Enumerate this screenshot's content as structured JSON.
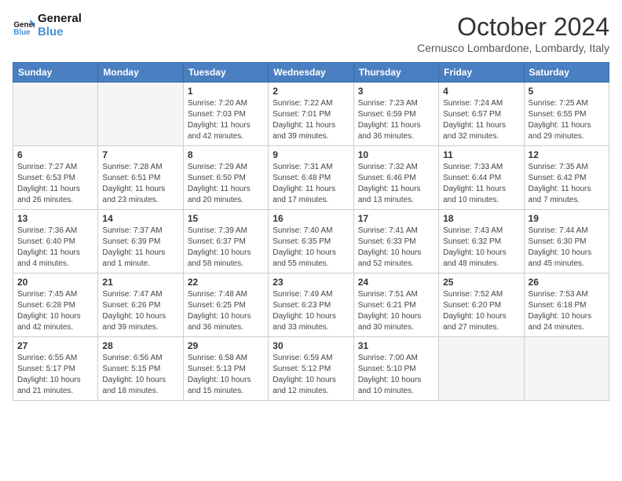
{
  "header": {
    "logo_line1": "General",
    "logo_line2": "Blue",
    "month": "October 2024",
    "location": "Cernusco Lombardone, Lombardy, Italy"
  },
  "weekdays": [
    "Sunday",
    "Monday",
    "Tuesday",
    "Wednesday",
    "Thursday",
    "Friday",
    "Saturday"
  ],
  "weeks": [
    [
      {
        "day": "",
        "info": ""
      },
      {
        "day": "",
        "info": ""
      },
      {
        "day": "1",
        "info": "Sunrise: 7:20 AM\nSunset: 7:03 PM\nDaylight: 11 hours and 42 minutes."
      },
      {
        "day": "2",
        "info": "Sunrise: 7:22 AM\nSunset: 7:01 PM\nDaylight: 11 hours and 39 minutes."
      },
      {
        "day": "3",
        "info": "Sunrise: 7:23 AM\nSunset: 6:59 PM\nDaylight: 11 hours and 36 minutes."
      },
      {
        "day": "4",
        "info": "Sunrise: 7:24 AM\nSunset: 6:57 PM\nDaylight: 11 hours and 32 minutes."
      },
      {
        "day": "5",
        "info": "Sunrise: 7:25 AM\nSunset: 6:55 PM\nDaylight: 11 hours and 29 minutes."
      }
    ],
    [
      {
        "day": "6",
        "info": "Sunrise: 7:27 AM\nSunset: 6:53 PM\nDaylight: 11 hours and 26 minutes."
      },
      {
        "day": "7",
        "info": "Sunrise: 7:28 AM\nSunset: 6:51 PM\nDaylight: 11 hours and 23 minutes."
      },
      {
        "day": "8",
        "info": "Sunrise: 7:29 AM\nSunset: 6:50 PM\nDaylight: 11 hours and 20 minutes."
      },
      {
        "day": "9",
        "info": "Sunrise: 7:31 AM\nSunset: 6:48 PM\nDaylight: 11 hours and 17 minutes."
      },
      {
        "day": "10",
        "info": "Sunrise: 7:32 AM\nSunset: 6:46 PM\nDaylight: 11 hours and 13 minutes."
      },
      {
        "day": "11",
        "info": "Sunrise: 7:33 AM\nSunset: 6:44 PM\nDaylight: 11 hours and 10 minutes."
      },
      {
        "day": "12",
        "info": "Sunrise: 7:35 AM\nSunset: 6:42 PM\nDaylight: 11 hours and 7 minutes."
      }
    ],
    [
      {
        "day": "13",
        "info": "Sunrise: 7:36 AM\nSunset: 6:40 PM\nDaylight: 11 hours and 4 minutes."
      },
      {
        "day": "14",
        "info": "Sunrise: 7:37 AM\nSunset: 6:39 PM\nDaylight: 11 hours and 1 minute."
      },
      {
        "day": "15",
        "info": "Sunrise: 7:39 AM\nSunset: 6:37 PM\nDaylight: 10 hours and 58 minutes."
      },
      {
        "day": "16",
        "info": "Sunrise: 7:40 AM\nSunset: 6:35 PM\nDaylight: 10 hours and 55 minutes."
      },
      {
        "day": "17",
        "info": "Sunrise: 7:41 AM\nSunset: 6:33 PM\nDaylight: 10 hours and 52 minutes."
      },
      {
        "day": "18",
        "info": "Sunrise: 7:43 AM\nSunset: 6:32 PM\nDaylight: 10 hours and 48 minutes."
      },
      {
        "day": "19",
        "info": "Sunrise: 7:44 AM\nSunset: 6:30 PM\nDaylight: 10 hours and 45 minutes."
      }
    ],
    [
      {
        "day": "20",
        "info": "Sunrise: 7:45 AM\nSunset: 6:28 PM\nDaylight: 10 hours and 42 minutes."
      },
      {
        "day": "21",
        "info": "Sunrise: 7:47 AM\nSunset: 6:26 PM\nDaylight: 10 hours and 39 minutes."
      },
      {
        "day": "22",
        "info": "Sunrise: 7:48 AM\nSunset: 6:25 PM\nDaylight: 10 hours and 36 minutes."
      },
      {
        "day": "23",
        "info": "Sunrise: 7:49 AM\nSunset: 6:23 PM\nDaylight: 10 hours and 33 minutes."
      },
      {
        "day": "24",
        "info": "Sunrise: 7:51 AM\nSunset: 6:21 PM\nDaylight: 10 hours and 30 minutes."
      },
      {
        "day": "25",
        "info": "Sunrise: 7:52 AM\nSunset: 6:20 PM\nDaylight: 10 hours and 27 minutes."
      },
      {
        "day": "26",
        "info": "Sunrise: 7:53 AM\nSunset: 6:18 PM\nDaylight: 10 hours and 24 minutes."
      }
    ],
    [
      {
        "day": "27",
        "info": "Sunrise: 6:55 AM\nSunset: 5:17 PM\nDaylight: 10 hours and 21 minutes."
      },
      {
        "day": "28",
        "info": "Sunrise: 6:56 AM\nSunset: 5:15 PM\nDaylight: 10 hours and 18 minutes."
      },
      {
        "day": "29",
        "info": "Sunrise: 6:58 AM\nSunset: 5:13 PM\nDaylight: 10 hours and 15 minutes."
      },
      {
        "day": "30",
        "info": "Sunrise: 6:59 AM\nSunset: 5:12 PM\nDaylight: 10 hours and 12 minutes."
      },
      {
        "day": "31",
        "info": "Sunrise: 7:00 AM\nSunset: 5:10 PM\nDaylight: 10 hours and 10 minutes."
      },
      {
        "day": "",
        "info": ""
      },
      {
        "day": "",
        "info": ""
      }
    ]
  ]
}
